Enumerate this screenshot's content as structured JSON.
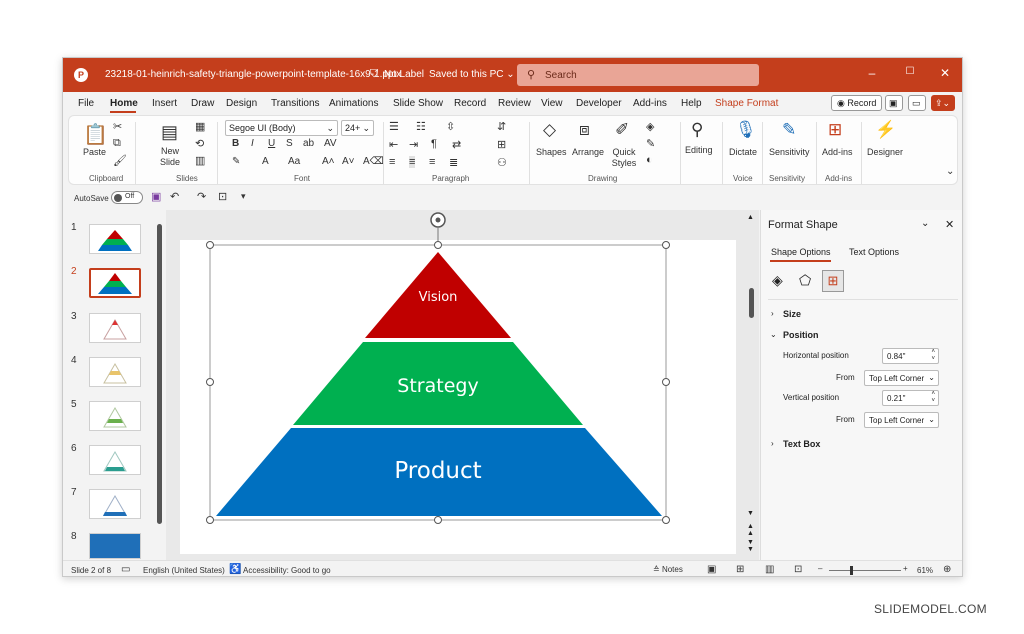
{
  "window": {
    "filename": "23218-01-heinrich-safety-triangle-powerpoint-template-16x9-1.pptx",
    "label": "No Label",
    "saved": "Saved to this PC",
    "search_placeholder": "Search"
  },
  "menu": {
    "tabs": [
      "File",
      "Home",
      "Insert",
      "Draw",
      "Design",
      "Transitions",
      "Animations",
      "Slide Show",
      "Record",
      "Review",
      "View",
      "Developer",
      "Add-ins",
      "Help",
      "Shape Format"
    ],
    "record_button": "Record"
  },
  "ribbon": {
    "paste": "Paste",
    "new_slide": "New Slide",
    "font_name": "Segoe UI (Body)",
    "font_size": "24+",
    "shapes": "Shapes",
    "arrange": "Arrange",
    "quick_styles": "Quick Styles",
    "editing": "Editing",
    "dictate": "Dictate",
    "sensitivity": "Sensitivity",
    "addins": "Add-ins",
    "designer": "Designer",
    "groups": {
      "clipboard": "Clipboard",
      "slides": "Slides",
      "font": "Font",
      "paragraph": "Paragraph",
      "drawing": "Drawing",
      "voice": "Voice",
      "sensitivity": "Sensitivity",
      "addins": "Add-ins"
    }
  },
  "qat": {
    "autosave": "AutoSave",
    "toggle": "Off"
  },
  "thumbnails": [
    "1",
    "2",
    "3",
    "4",
    "5",
    "6",
    "7",
    "8"
  ],
  "slide": {
    "tier1": "Vision",
    "tier2": "Strategy",
    "tier3": "Product",
    "colors": {
      "vision": "#c00000",
      "strategy": "#00b050",
      "product": "#0070c0"
    }
  },
  "format_pane": {
    "title": "Format Shape",
    "tab_shape": "Shape Options",
    "tab_text": "Text Options",
    "size": "Size",
    "position": "Position",
    "h_label": "Horizontal position",
    "h_value": "0.84\"",
    "from_label": "From",
    "h_from": "Top Left Corner",
    "v_label": "Vertical position",
    "v_value": "0.21\"",
    "v_from": "Top Left Corner",
    "textbox": "Text Box"
  },
  "status": {
    "slide_info": "Slide 2 of 8",
    "language": "English (United States)",
    "accessibility": "Accessibility: Good to go",
    "notes": "Notes",
    "zoom": "61%"
  },
  "watermark": "SLIDEMODEL.COM",
  "theme": {
    "accent": "#c43e1c"
  }
}
